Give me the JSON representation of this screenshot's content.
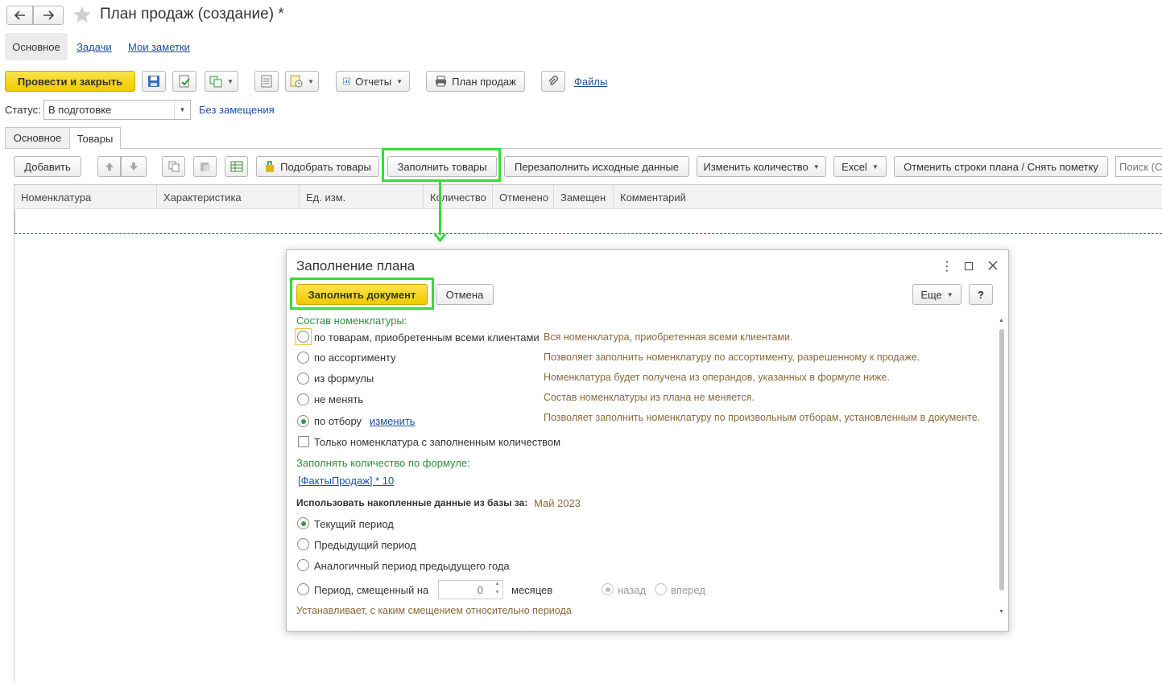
{
  "window": {
    "title": "План продаж (создание) *",
    "tabs": [
      "Основное",
      "Задачи",
      "Мои заметки"
    ]
  },
  "toolbar": {
    "post_close": "Провести и закрыть",
    "reports": "Отчеты",
    "sales_plan": "План продаж",
    "files": "Файлы"
  },
  "status": {
    "label": "Статус:",
    "value": "В подготовке",
    "no_substitution": "Без замещения"
  },
  "form_tabs": [
    "Основное",
    "Товары"
  ],
  "goods_toolbar": {
    "add": "Добавить",
    "pick": "Подобрать товары",
    "fill": "Заполнить товары",
    "refill": "Перезаполнить исходные данные",
    "change_qty": "Изменить количество",
    "excel": "Excel",
    "cancel_rows": "Отменить строки плана / Снять пометку",
    "search_placeholder": "Поиск (Ctrl+F)"
  },
  "table": {
    "columns": [
      "Номенклатура",
      "Характеристика",
      "Ед. изм.",
      "Количество",
      "Отменено",
      "Замещен",
      "Комментарий"
    ]
  },
  "dialog": {
    "title": "Заполнение плана",
    "fill_doc": "Заполнить документ",
    "cancel": "Отмена",
    "more": "Еще",
    "help": "?",
    "composition_title": "Состав номенклатуры:",
    "options": [
      {
        "label": "по товарам, приобретенным всеми клиентами",
        "desc": "Вся номенклатура, приобретенная всеми клиентами.",
        "checked": false
      },
      {
        "label": "по ассортименту",
        "desc": "Позволяет заполнить номенклатуру по ассортименту, разрешенному к продаже.",
        "checked": false
      },
      {
        "label": "из формулы",
        "desc": "Номенклатура будет получена из операндов, указанных в формуле ниже.",
        "checked": false
      },
      {
        "label": "не менять",
        "desc": "Состав номенклатуры из плана не меняется.",
        "checked": false
      },
      {
        "label": "по отбору",
        "desc": "Позволяет заполнить номенклатуру по произвольным отборам, установленным в документе.",
        "checked": true
      }
    ],
    "change_link": "изменить",
    "only_filled_qty": "Только номенклатура с заполненным количеством",
    "qty_formula_title": "Заполнять количество по формуле:",
    "formula": "[ФактыПродаж] * 10",
    "accum_label": "Использовать накопленные данные из базы за:",
    "accum_value": "Май 2023",
    "periods": [
      {
        "label": "Текущий период",
        "checked": true
      },
      {
        "label": "Предыдущий период",
        "checked": false
      },
      {
        "label": "Аналогичный период предыдущего года",
        "checked": false
      },
      {
        "label": "Период, смещенный на",
        "checked": false
      }
    ],
    "shift_value": "0",
    "months": "месяцев",
    "back": "назад",
    "forward": "вперед",
    "shift_desc": "Устанавливает, с каким смещением относительно периода"
  },
  "colors": {
    "accent_yellow": "#f5d10a",
    "highlight_green": "#35dd35",
    "link_blue": "#1c4fa6",
    "section_green": "#2f8f3b"
  }
}
